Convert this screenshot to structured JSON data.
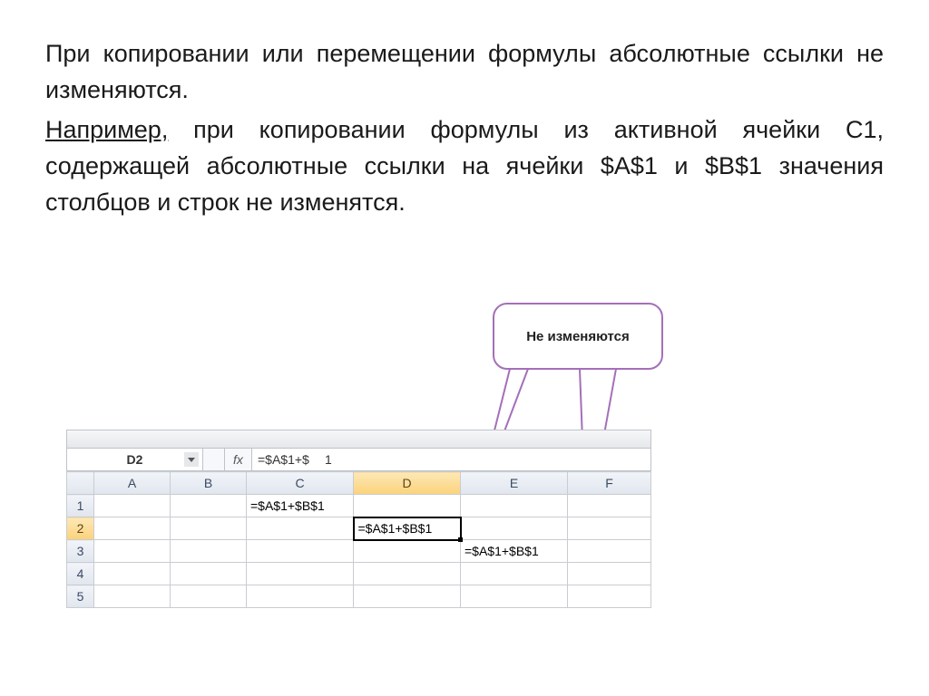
{
  "paragraph1_a": "При копировании или перемещении формулы абсолютные ссылки не изменяются.",
  "paragraph2_prefix": "Например,",
  "paragraph2_rest": " при копировании формулы из активной ячейки С1, содержащей абсолютные ссылки на ячейки $А$1 и $В$1 значения столбцов и строк не изменятся.",
  "callout": "Не изменяются",
  "excel": {
    "namebox": "D2",
    "fx_label": "fx",
    "formula": "=$A$1+$B$1",
    "formula_clipped": "=$A$1+$",
    "formula_clipped2": "1",
    "columns": [
      "A",
      "B",
      "C",
      "D",
      "E",
      "F"
    ],
    "rows": [
      "1",
      "2",
      "3",
      "4",
      "5"
    ],
    "cells": {
      "C1": "=$A$1+$B$1",
      "D2": "=$A$1+$B$1",
      "E3": "=$A$1+$B$1"
    }
  }
}
